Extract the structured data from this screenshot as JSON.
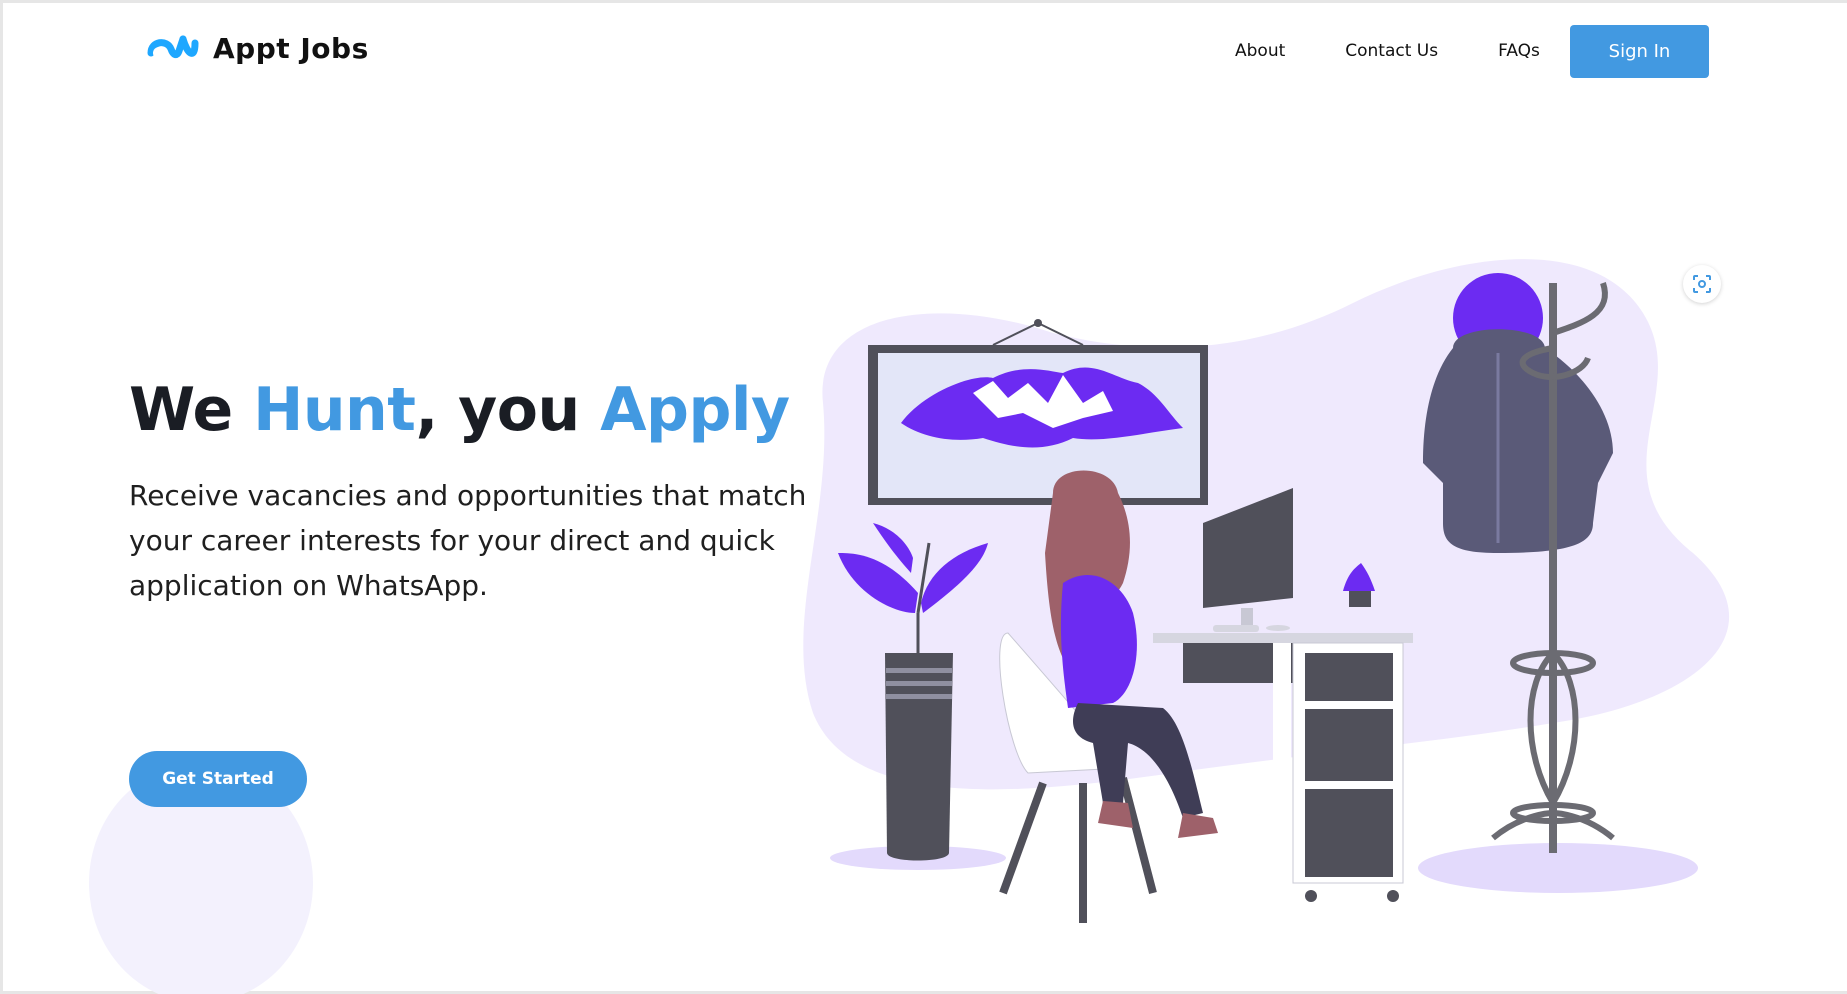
{
  "brand": {
    "name": "Appt Jobs",
    "logo_icon": "appt-jobs-logo-icon",
    "color": "#1ea7ff"
  },
  "nav": {
    "about": "About",
    "contact": "Contact Us",
    "faqs": "FAQs",
    "signin": "Sign In"
  },
  "hero": {
    "title_part1": "We ",
    "title_accent1": "Hunt",
    "title_part2": ", you ",
    "title_accent2": "Apply",
    "subtitle": "Receive vacancies and opportunities that match your career interests for your direct and quick application on WhatsApp.",
    "cta": "Get Started"
  },
  "illustration": {
    "subject": "woman-at-desk-illustration"
  },
  "lens": {
    "icon": "visual-search-icon"
  },
  "colors": {
    "accent": "#4299e1",
    "purple": "#6c2bf2",
    "blob": "#efe9fd",
    "dark": "#50505a"
  }
}
